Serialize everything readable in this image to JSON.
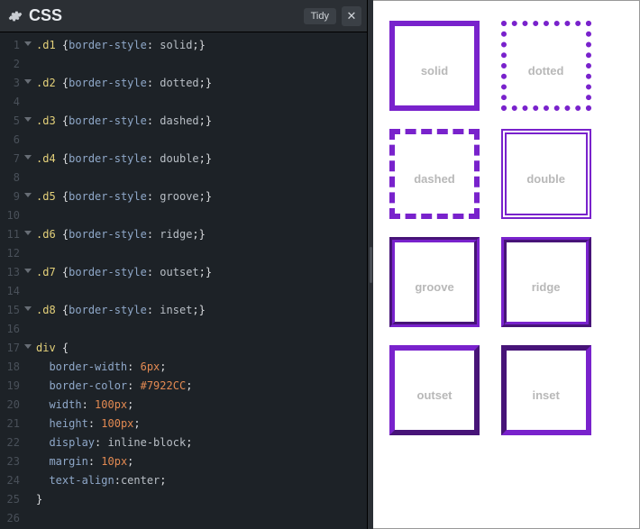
{
  "header": {
    "title": "CSS",
    "tidy": "Tidy",
    "close": "✕"
  },
  "code": {
    "lines": [
      {
        "n": "1",
        "fold": true,
        "tokens": [
          [
            "sel",
            ".d1 "
          ],
          [
            "brace",
            "{"
          ],
          [
            "prop",
            "border-style"
          ],
          [
            "colon",
            ": "
          ],
          [
            "val",
            "solid"
          ],
          [
            "semi",
            ";"
          ],
          [
            "brace",
            "}"
          ]
        ]
      },
      {
        "n": "2",
        "tokens": []
      },
      {
        "n": "3",
        "fold": true,
        "tokens": [
          [
            "sel",
            ".d2 "
          ],
          [
            "brace",
            "{"
          ],
          [
            "prop",
            "border-style"
          ],
          [
            "colon",
            ": "
          ],
          [
            "val",
            "dotted"
          ],
          [
            "semi",
            ";"
          ],
          [
            "brace",
            "}"
          ]
        ]
      },
      {
        "n": "4",
        "tokens": []
      },
      {
        "n": "5",
        "fold": true,
        "tokens": [
          [
            "sel",
            ".d3 "
          ],
          [
            "brace",
            "{"
          ],
          [
            "prop",
            "border-style"
          ],
          [
            "colon",
            ": "
          ],
          [
            "val",
            "dashed"
          ],
          [
            "semi",
            ";"
          ],
          [
            "brace",
            "}"
          ]
        ]
      },
      {
        "n": "6",
        "tokens": []
      },
      {
        "n": "7",
        "fold": true,
        "tokens": [
          [
            "sel",
            ".d4 "
          ],
          [
            "brace",
            "{"
          ],
          [
            "prop",
            "border-style"
          ],
          [
            "colon",
            ": "
          ],
          [
            "val",
            "double"
          ],
          [
            "semi",
            ";"
          ],
          [
            "brace",
            "}"
          ]
        ]
      },
      {
        "n": "8",
        "tokens": []
      },
      {
        "n": "9",
        "fold": true,
        "tokens": [
          [
            "sel",
            ".d5 "
          ],
          [
            "brace",
            "{"
          ],
          [
            "prop",
            "border-style"
          ],
          [
            "colon",
            ": "
          ],
          [
            "val",
            "groove"
          ],
          [
            "semi",
            ";"
          ],
          [
            "brace",
            "}"
          ]
        ]
      },
      {
        "n": "10",
        "tokens": []
      },
      {
        "n": "11",
        "fold": true,
        "tokens": [
          [
            "sel",
            ".d6 "
          ],
          [
            "brace",
            "{"
          ],
          [
            "prop",
            "border-style"
          ],
          [
            "colon",
            ": "
          ],
          [
            "val",
            "ridge"
          ],
          [
            "semi",
            ";"
          ],
          [
            "brace",
            "}"
          ]
        ]
      },
      {
        "n": "12",
        "tokens": []
      },
      {
        "n": "13",
        "fold": true,
        "tokens": [
          [
            "sel",
            ".d7 "
          ],
          [
            "brace",
            "{"
          ],
          [
            "prop",
            "border-style"
          ],
          [
            "colon",
            ": "
          ],
          [
            "val",
            "outset"
          ],
          [
            "semi",
            ";"
          ],
          [
            "brace",
            "}"
          ]
        ]
      },
      {
        "n": "14",
        "tokens": []
      },
      {
        "n": "15",
        "fold": true,
        "tokens": [
          [
            "sel",
            ".d8 "
          ],
          [
            "brace",
            "{"
          ],
          [
            "prop",
            "border-style"
          ],
          [
            "colon",
            ": "
          ],
          [
            "val",
            "inset"
          ],
          [
            "semi",
            ";"
          ],
          [
            "brace",
            "}"
          ]
        ]
      },
      {
        "n": "16",
        "tokens": []
      },
      {
        "n": "17",
        "fold": true,
        "tokens": [
          [
            "sel",
            "div "
          ],
          [
            "brace",
            "{"
          ]
        ]
      },
      {
        "n": "18",
        "tokens": [
          [
            "val",
            "  "
          ],
          [
            "prop",
            "border-width"
          ],
          [
            "colon",
            ": "
          ],
          [
            "num",
            "6px"
          ],
          [
            "semi",
            ";"
          ]
        ]
      },
      {
        "n": "19",
        "tokens": [
          [
            "val",
            "  "
          ],
          [
            "prop",
            "border-color"
          ],
          [
            "colon",
            ": "
          ],
          [
            "hex",
            "#7922CC"
          ],
          [
            "semi",
            ";"
          ]
        ]
      },
      {
        "n": "20",
        "tokens": [
          [
            "val",
            "  "
          ],
          [
            "prop",
            "width"
          ],
          [
            "colon",
            ": "
          ],
          [
            "num",
            "100px"
          ],
          [
            "semi",
            ";"
          ]
        ]
      },
      {
        "n": "21",
        "tokens": [
          [
            "val",
            "  "
          ],
          [
            "prop",
            "height"
          ],
          [
            "colon",
            ": "
          ],
          [
            "num",
            "100px"
          ],
          [
            "semi",
            ";"
          ]
        ]
      },
      {
        "n": "22",
        "tokens": [
          [
            "val",
            "  "
          ],
          [
            "prop",
            "display"
          ],
          [
            "colon",
            ": "
          ],
          [
            "val",
            "inline-block"
          ],
          [
            "semi",
            ";"
          ]
        ]
      },
      {
        "n": "23",
        "tokens": [
          [
            "val",
            "  "
          ],
          [
            "prop",
            "margin"
          ],
          [
            "colon",
            ": "
          ],
          [
            "num",
            "10px"
          ],
          [
            "semi",
            ";"
          ]
        ]
      },
      {
        "n": "24",
        "tokens": [
          [
            "val",
            "  "
          ],
          [
            "prop",
            "text-align"
          ],
          [
            "colon",
            ":"
          ],
          [
            "val",
            "center"
          ],
          [
            "semi",
            ";"
          ]
        ]
      },
      {
        "n": "25",
        "tokens": [
          [
            "brace",
            "}"
          ]
        ]
      },
      {
        "n": "26",
        "tokens": []
      }
    ]
  },
  "preview": {
    "boxes": [
      "solid",
      "dotted",
      "dashed",
      "double",
      "groove",
      "ridge",
      "outset",
      "inset"
    ]
  }
}
